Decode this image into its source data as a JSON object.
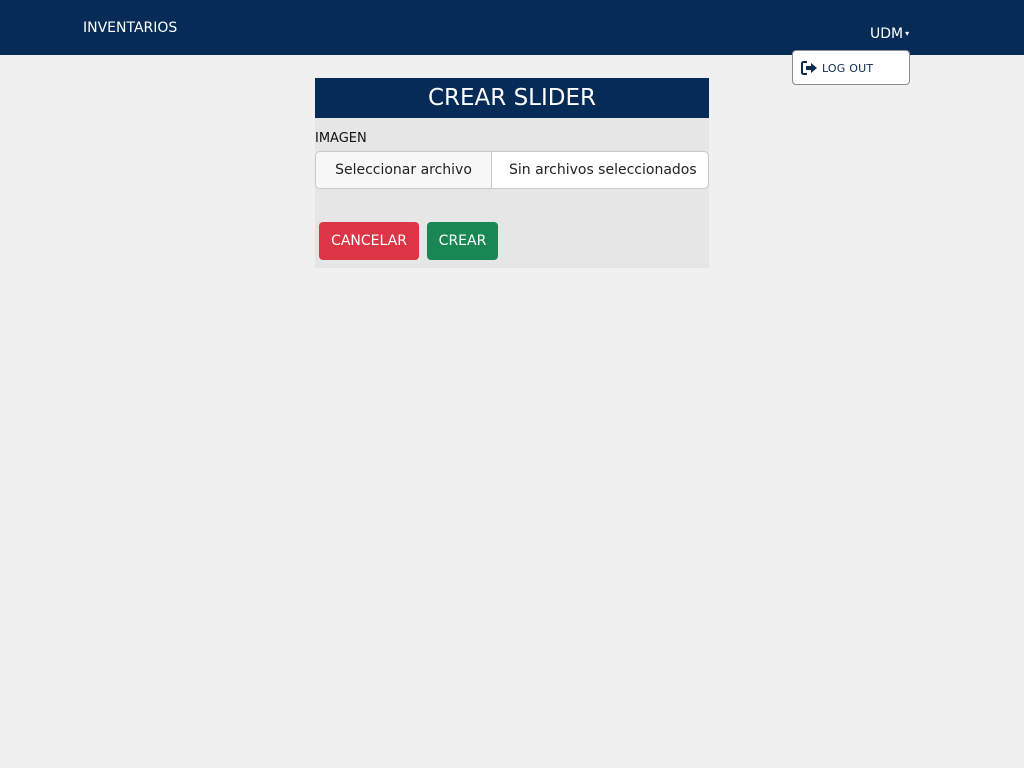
{
  "navbar": {
    "brand": "INVENTARIOS",
    "user_label": "UDM",
    "caret": "▾"
  },
  "dropdown": {
    "items": [
      {
        "label": "LOG OUT",
        "icon": "logout-icon"
      }
    ]
  },
  "form": {
    "title": "CREAR SLIDER",
    "image_label": "IMAGEN",
    "file_button_label": "Seleccionar archivo",
    "file_status": "Sin archivos seleccionados",
    "cancel_label": "CANCELAR",
    "create_label": "CREAR"
  },
  "colors": {
    "navbar_bg": "#062b56",
    "page_bg": "#f0f0f0",
    "card_bg": "#e6e6e6",
    "cancel_bg": "#dc3545",
    "create_bg": "#198754"
  }
}
